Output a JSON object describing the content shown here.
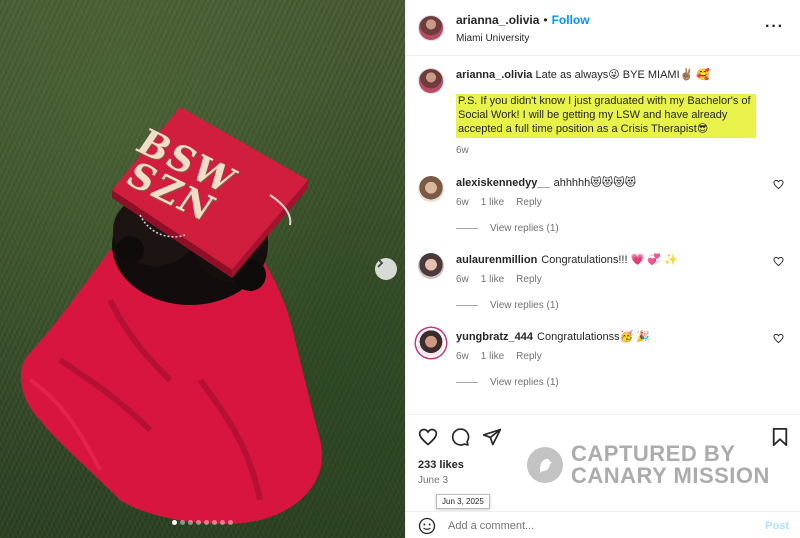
{
  "post": {
    "username": "arianna_.olivia",
    "follow_label": "Follow",
    "location": "Miami University"
  },
  "caption": {
    "username": "arianna_.olivia",
    "text1": "Late as always😜  BYE MIAMI✌🏽 🥰",
    "text2": "P.S. If you didn't know I just graduated with my Bachelor's of Social Work! I will be getting my LSW and have already accepted a full time position as a Crisis Therapist😎",
    "time": "6w"
  },
  "comments": [
    {
      "username": "alexiskennedyy__",
      "text": "ahhhhh😻😻😻😻",
      "time": "6w",
      "likes": "1 like",
      "reply_label": "Reply",
      "view_replies": "View replies (1)"
    },
    {
      "username": "aulaurenmillion",
      "text": "Congratulations!!! 💗 💞 ✨",
      "time": "6w",
      "likes": "1 like",
      "reply_label": "Reply",
      "view_replies": "View replies (1)"
    },
    {
      "username": "yungbratz_444",
      "text": "Congratulationss🥳 🎉",
      "time": "6w",
      "likes": "1 like",
      "reply_label": "Reply",
      "view_replies": "View replies (1)"
    }
  ],
  "actions": {
    "likes": "233 likes",
    "date": "June 3",
    "date_tooltip": "Jun 3, 2025",
    "comment_placeholder": "Add a comment...",
    "post_label": "Post"
  },
  "cap_text": {
    "line1": "BSW",
    "line2": "SZN"
  },
  "watermark": {
    "line1": "CAPTURED BY",
    "line2": "CANARY MISSION"
  },
  "colors": {
    "accent": "#0095f6",
    "highlight": "#e8f24a",
    "gown": "#d8153f"
  },
  "carousel": {
    "dot_count": 8,
    "active_index": 0
  }
}
